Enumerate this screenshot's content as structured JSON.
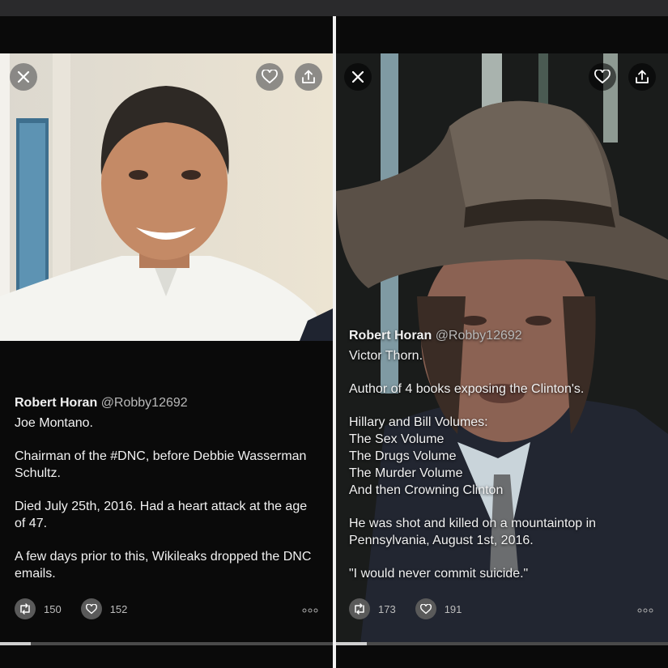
{
  "colors": {
    "panel_bg": "#0a0a0a",
    "text": "#f1f1f1",
    "handle": "#b9b9b9",
    "divider": "#f2f2f2"
  },
  "icons": {
    "close": "close-icon",
    "like": "heart-icon",
    "share": "share-icon",
    "retweet": "retweet-icon",
    "more": "more-icon"
  },
  "left": {
    "author": "Robert Horan",
    "handle": "@Robby12692",
    "paragraphs": [
      "Joe Montano.",
      "Chairman of the #DNC, before Debbie Wasserman Schultz.",
      "Died July 25th, 2016. Had a heart attack at the age of 47.",
      "A few days prior to this, Wikileaks dropped the DNC emails."
    ],
    "retweets": "150",
    "likes": "152"
  },
  "right": {
    "author": "Robert Horan",
    "handle": "@Robby12692",
    "line1": "Victor Thorn.",
    "line2": "Author of 4 books exposing the Clinton's.",
    "volumes_header": "Hillary and Bill Volumes:",
    "volumes": [
      "The Sex Volume",
      "The Drugs Volume",
      "The Murder Volume",
      "And then Crowning Clinton"
    ],
    "line3": "He was shot and killed on a mountaintop in Pennsylvania, August 1st, 2016.",
    "quote": "\"I would never commit suicide.\"",
    "retweets": "173",
    "likes": "191"
  }
}
